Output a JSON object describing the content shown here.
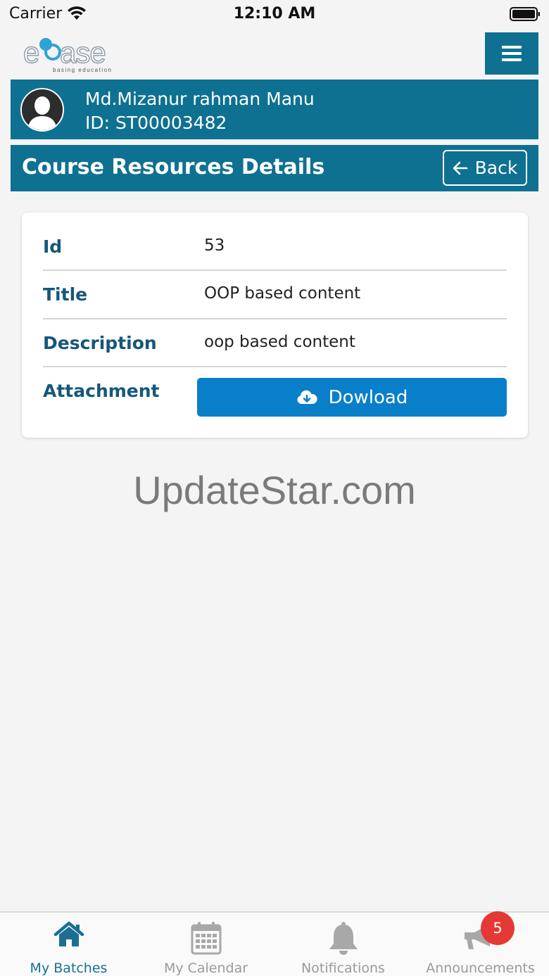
{
  "status_bar": {
    "carrier": "Carrier",
    "time": "12:10 AM"
  },
  "header": {
    "logo_text": "edbase",
    "logo_tagline": "basing education",
    "menu_icon": "hamburger-menu-icon"
  },
  "profile": {
    "name": "Md.Mizanur rahman Manu",
    "id": "ID: ST00003482",
    "avatar_icon": "user-silhouette-icon"
  },
  "page": {
    "title": "Course Resources Details",
    "back_label": "Back",
    "back_icon": "arrow-left-icon"
  },
  "details": {
    "rows": [
      {
        "label": "Id",
        "value": "53"
      },
      {
        "label": "Title",
        "value": "OOP based content"
      },
      {
        "label": "Description",
        "value": "oop based content"
      },
      {
        "label": "Attachment",
        "value": ""
      }
    ],
    "download_label": "Dowload",
    "download_icon": "cloud-download-icon"
  },
  "watermark": "UpdateStar.com",
  "tabs": [
    {
      "label": "My Batches",
      "icon": "home-icon",
      "active": true
    },
    {
      "label": "My Calendar",
      "icon": "calendar-icon",
      "active": false
    },
    {
      "label": "Notifications",
      "icon": "bell-icon",
      "active": false
    },
    {
      "label": "Announcements",
      "icon": "megaphone-icon",
      "active": false
    }
  ],
  "announcements_badge": "5",
  "colors": {
    "primary": "#0e7191",
    "button_blue": "#0a7fc9",
    "label_blue": "#16577a",
    "badge_red": "#e53935"
  }
}
